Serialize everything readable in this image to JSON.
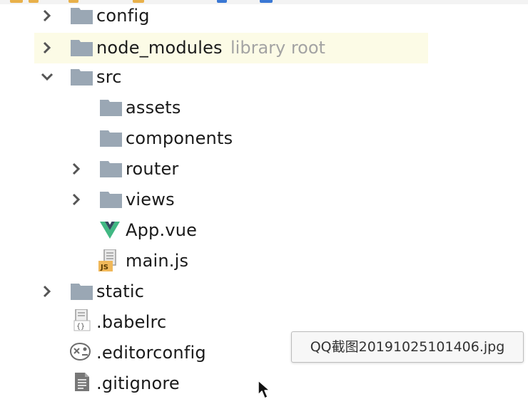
{
  "tree": {
    "items": [
      {
        "label": "config",
        "icon": "folder-icon",
        "expander": "chevron-right"
      },
      {
        "label": "node_modules",
        "suffix": "library root",
        "icon": "folder-icon",
        "expander": "chevron-right",
        "highlighted": true
      },
      {
        "label": "src",
        "icon": "folder-icon",
        "expander": "chevron-down"
      },
      {
        "label": "assets",
        "icon": "folder-icon",
        "expander": "none"
      },
      {
        "label": "components",
        "icon": "folder-icon",
        "expander": "none"
      },
      {
        "label": "router",
        "icon": "folder-icon",
        "expander": "chevron-right"
      },
      {
        "label": "views",
        "icon": "folder-icon",
        "expander": "chevron-right"
      },
      {
        "label": "App.vue",
        "icon": "vue-file-icon",
        "expander": "none"
      },
      {
        "label": "main.js",
        "icon": "js-file-icon",
        "expander": "none"
      },
      {
        "label": "static",
        "icon": "folder-icon",
        "expander": "chevron-right"
      },
      {
        "label": ".babelrc",
        "icon": "json-config-file-icon",
        "expander": "none"
      },
      {
        "label": ".editorconfig",
        "icon": "editorconfig-file-icon",
        "expander": "none"
      },
      {
        "label": ".gitignore",
        "icon": "text-file-icon",
        "expander": "none"
      }
    ]
  },
  "tooltip": {
    "text": "QQ截图20191025101406.jpg"
  },
  "colors": {
    "folder": "#9aa7b4",
    "highlight_row": "#fcfbe6",
    "muted_text": "#a3a3a3",
    "vue_green": "#41b883",
    "vue_dark": "#35495e",
    "js_badge": "#f0b85a"
  }
}
